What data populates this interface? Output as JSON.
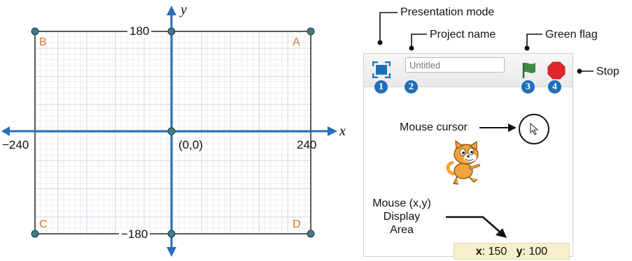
{
  "plane": {
    "x_axis_name": "x",
    "y_axis_name": "y",
    "origin_label": "(0,0)",
    "x_max_label": "240",
    "x_min_label": "−240",
    "y_max_label": "180",
    "y_min_label": "−180",
    "corners": {
      "a": "A",
      "b": "B",
      "c": "C",
      "d": "D"
    },
    "x_range": [
      -240,
      240
    ],
    "y_range": [
      -180,
      180
    ],
    "colors": {
      "axis": "#2a6db8",
      "grid": "#e2e6ee",
      "border": "#222222",
      "corner_label": "#d9742c",
      "point": "#3f7c83"
    }
  },
  "stage": {
    "project_name_placeholder": "Untitled",
    "badges": [
      "1",
      "2",
      "3",
      "4"
    ],
    "mouse": {
      "x_label": "x",
      "x_value": "150",
      "y_label": "y",
      "y_value": "100"
    }
  },
  "callouts": {
    "presentation_mode": "Presentation mode",
    "project_name": "Project name",
    "green_flag": "Green flag",
    "stop": "Stop",
    "mouse_cursor": "Mouse cursor",
    "mouse_display_line1": "Mouse (x,y)",
    "mouse_display_line2": "Display",
    "mouse_display_line3": "Area"
  }
}
